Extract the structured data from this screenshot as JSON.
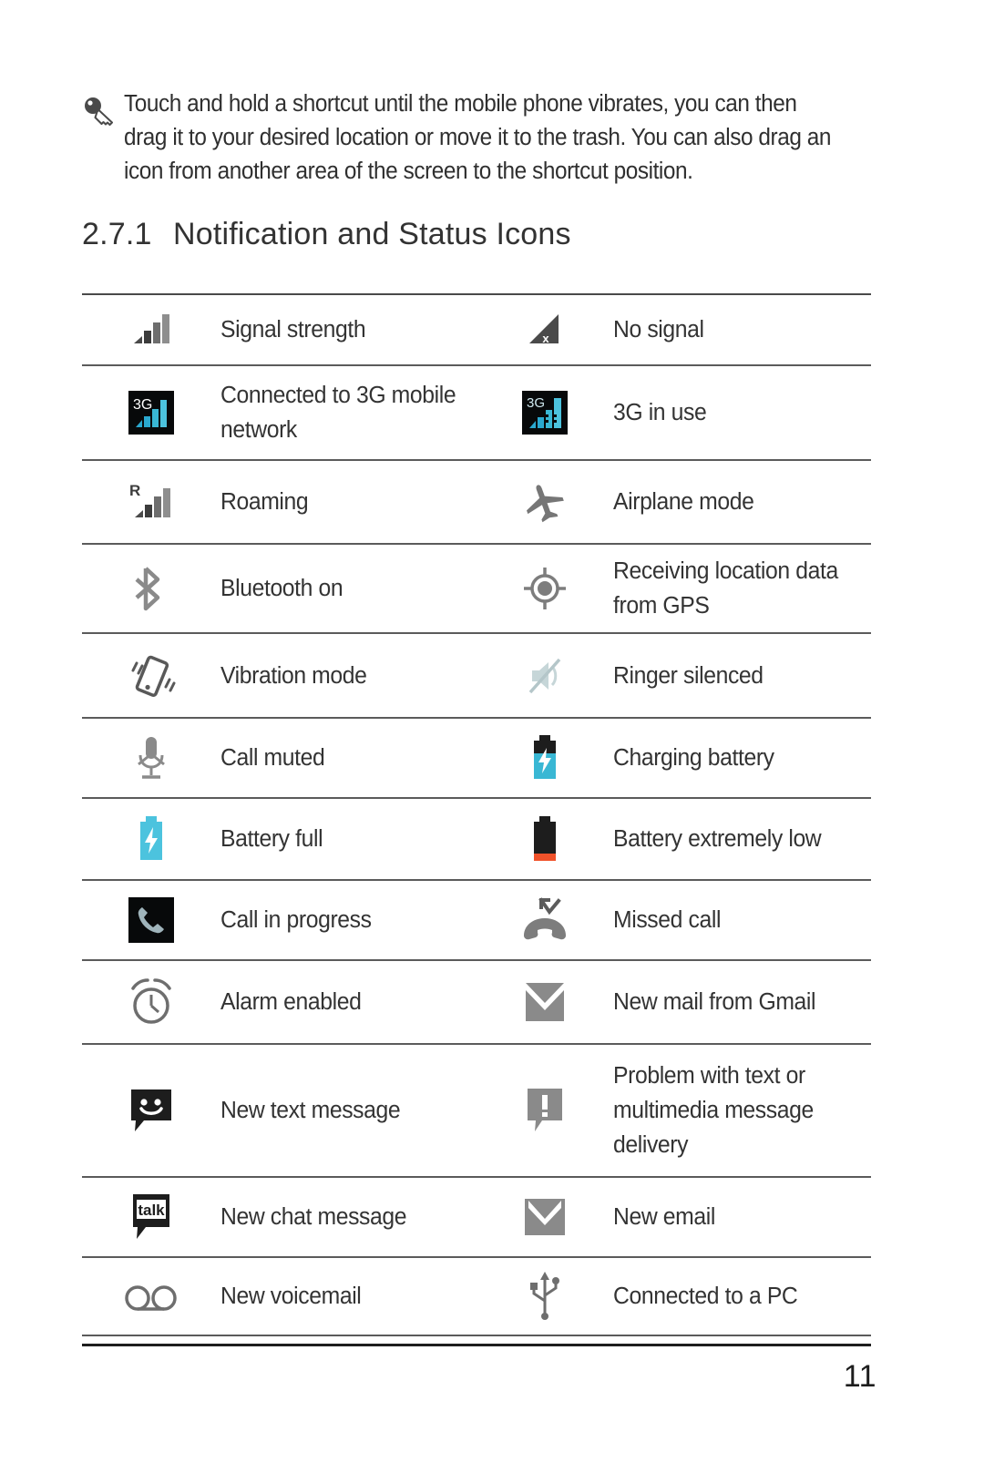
{
  "tip": {
    "icon": "key-icon",
    "text": "Touch and hold a shortcut until the mobile phone vibrates, you can then drag it to your desired location or move it to the trash. You can also drag an icon from another area of the screen to the shortcut position."
  },
  "heading": {
    "number": "2.7.1",
    "title": "Notification and Status Icons"
  },
  "table": {
    "rows": [
      {
        "left": {
          "icon": "signal-strength-icon",
          "label": "Signal strength"
        },
        "right": {
          "icon": "no-signal-icon",
          "label": "No signal"
        }
      },
      {
        "left": {
          "icon": "3g-connected-icon",
          "label": "Connected to 3G mobile network"
        },
        "right": {
          "icon": "3g-in-use-icon",
          "label": "3G in use"
        }
      },
      {
        "left": {
          "icon": "roaming-icon",
          "label": "Roaming"
        },
        "right": {
          "icon": "airplane-mode-icon",
          "label": "Airplane mode"
        }
      },
      {
        "left": {
          "icon": "bluetooth-icon",
          "label": "Bluetooth on"
        },
        "right": {
          "icon": "gps-icon",
          "label": "Receiving location data from GPS"
        }
      },
      {
        "left": {
          "icon": "vibration-mode-icon",
          "label": "Vibration mode"
        },
        "right": {
          "icon": "ringer-silenced-icon",
          "label": "Ringer silenced"
        }
      },
      {
        "left": {
          "icon": "microphone-muted-icon",
          "label": "Call muted"
        },
        "right": {
          "icon": "charging-battery-icon",
          "label": "Charging battery"
        }
      },
      {
        "left": {
          "icon": "battery-full-icon",
          "label": "Battery full"
        },
        "right": {
          "icon": "battery-low-icon",
          "label": "Battery extremely low"
        }
      },
      {
        "left": {
          "icon": "call-in-progress-icon",
          "label": "Call in progress"
        },
        "right": {
          "icon": "missed-call-icon",
          "label": "Missed call"
        }
      },
      {
        "left": {
          "icon": "alarm-clock-icon",
          "label": "Alarm enabled"
        },
        "right": {
          "icon": "gmail-icon",
          "label": "New mail from Gmail"
        }
      },
      {
        "left": {
          "icon": "new-text-message-icon",
          "label": "New text message"
        },
        "right": {
          "icon": "message-problem-icon",
          "label": "Problem with text or multimedia message delivery"
        }
      },
      {
        "left": {
          "icon": "talk-chat-icon",
          "label": "New chat message"
        },
        "right": {
          "icon": "new-email-icon",
          "label": "New email"
        }
      },
      {
        "left": {
          "icon": "voicemail-icon",
          "label": "New voicemail"
        },
        "right": {
          "icon": "usb-icon",
          "label": "Connected to a PC"
        }
      }
    ]
  },
  "footer": {
    "page_number": "11"
  },
  "colors": {
    "text": "#333333",
    "rule": "#5b5b5b",
    "accent_cyan": "#39b7d4",
    "accent_orange": "#f0522a",
    "icon_gray": "#7d7d7d",
    "icon_dark": "#4a4a4a"
  }
}
